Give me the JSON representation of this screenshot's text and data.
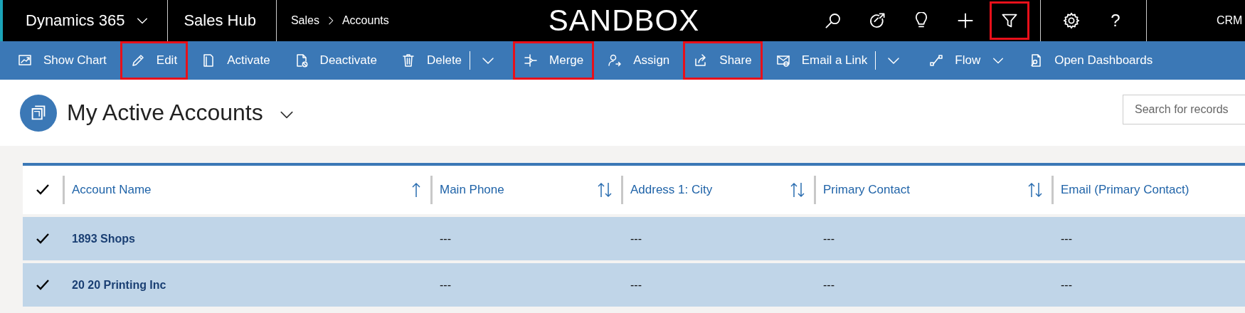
{
  "top_bar": {
    "app_name": "Dynamics 365",
    "area": "Sales Hub",
    "breadcrumb": [
      "Sales",
      "Accounts"
    ],
    "environment": "SANDBOX",
    "icons": [
      {
        "kind": "search",
        "highlighted": false
      },
      {
        "kind": "target",
        "highlighted": false
      },
      {
        "kind": "bulb",
        "highlighted": false
      },
      {
        "kind": "plus",
        "highlighted": false
      },
      {
        "kind": "filter",
        "highlighted": true
      },
      {
        "kind": "settings",
        "highlighted": false
      },
      {
        "kind": "help",
        "label": "?",
        "highlighted": false
      }
    ],
    "user": "CRM"
  },
  "commands": [
    {
      "kind": "command",
      "label": "Show Chart",
      "highlighted": false
    },
    {
      "kind": "command",
      "label": "Edit",
      "highlighted": true
    },
    {
      "kind": "command",
      "label": "Activate",
      "highlighted": false
    },
    {
      "kind": "command",
      "label": "Deactivate",
      "highlighted": false
    },
    {
      "kind": "command",
      "label": "Delete",
      "highlighted": false
    },
    {
      "kind": "split"
    },
    {
      "kind": "command",
      "label": "Merge",
      "highlighted": true
    },
    {
      "kind": "command",
      "label": "Assign",
      "highlighted": false
    },
    {
      "kind": "command",
      "label": "Share",
      "highlighted": true
    },
    {
      "kind": "command",
      "label": "Email a Link",
      "highlighted": false
    },
    {
      "kind": "split"
    },
    {
      "kind": "command",
      "label": "Flow",
      "has_menu": true,
      "highlighted": false
    },
    {
      "kind": "command",
      "label": "Open Dashboards",
      "highlighted": false
    }
  ],
  "view": {
    "title": "My Active Accounts",
    "search": {
      "placeholder": "Search for records"
    }
  },
  "grid": {
    "all_selected": true,
    "columns": [
      {
        "label": "Account Name",
        "kind": "sorted"
      },
      {
        "label": "Main Phone",
        "kind": "sortable"
      },
      {
        "label": "Address 1: City",
        "kind": "sortable"
      },
      {
        "label": "Primary Contact",
        "kind": "sortable"
      },
      {
        "label": "Email (Primary Contact)",
        "kind": "plain"
      }
    ],
    "rows": [
      {
        "selected": true,
        "cells": [
          "1893 Shops",
          "---",
          "---",
          "---",
          "---"
        ]
      },
      {
        "selected": true,
        "cells": [
          "20 20 Printing Inc",
          "---",
          "---",
          "---",
          "---"
        ]
      }
    ]
  }
}
